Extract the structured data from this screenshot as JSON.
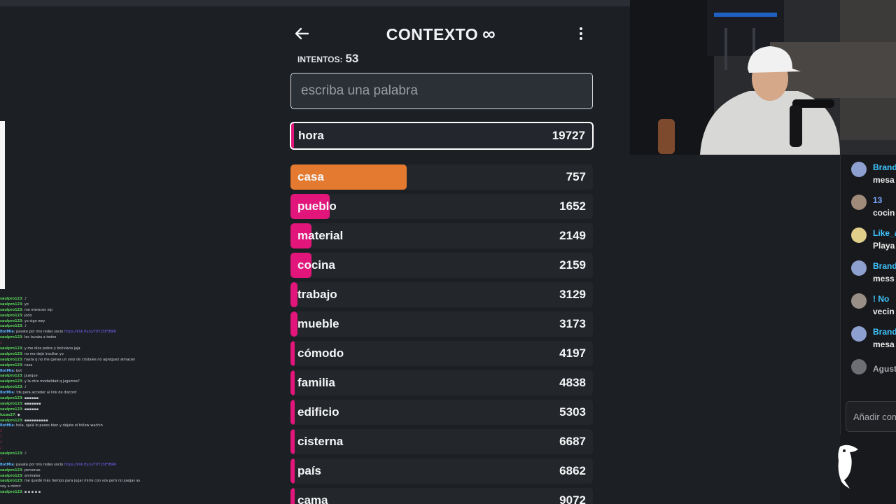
{
  "game": {
    "title": "CONTEXTO",
    "title_symbol": "∞",
    "tries_label": "INTENTOS:",
    "tries_value": "53",
    "input_placeholder": "escriba una palabra",
    "current_guess": {
      "word": "hora",
      "score": "19727"
    },
    "guesses": [
      {
        "word": "casa",
        "score": "757",
        "fill": 0.385,
        "color": "#e47a30"
      },
      {
        "word": "pueblo",
        "score": "1652",
        "fill": 0.13,
        "color": "#e2157a"
      },
      {
        "word": "material",
        "score": "2149",
        "fill": 0.07,
        "color": "#e2157a"
      },
      {
        "word": "cocina",
        "score": "2159",
        "fill": 0.07,
        "color": "#e2157a"
      },
      {
        "word": "trabajo",
        "score": "3129",
        "fill": 0.022,
        "color": "#e2157a"
      },
      {
        "word": "mueble",
        "score": "3173",
        "fill": 0.022,
        "color": "#e2157a"
      },
      {
        "word": "cómodo",
        "score": "4197",
        "fill": 0.012,
        "color": "#e2157a"
      },
      {
        "word": "familia",
        "score": "4838",
        "fill": 0.01,
        "color": "#e2157a"
      },
      {
        "word": "edificio",
        "score": "5303",
        "fill": 0.01,
        "color": "#e2157a"
      },
      {
        "word": "cisterna",
        "score": "6687",
        "fill": 0.01,
        "color": "#e2157a"
      },
      {
        "word": "país",
        "score": "6862",
        "fill": 0.01,
        "color": "#e2157a"
      },
      {
        "word": "cama",
        "score": "9072",
        "fill": 0.01,
        "color": "#e2157a"
      }
    ]
  },
  "right_chat": {
    "messages": [
      {
        "name": "Brand",
        "msg": "mesa",
        "avatar_color": "#8ea0cf",
        "name_color": "#3ec5ff"
      },
      {
        "name": "13",
        "msg": "cocin",
        "avatar_color": "#a08a7a",
        "name_color": "#7aa7ff"
      },
      {
        "name": "Like_a",
        "msg": "Playa",
        "avatar_color": "#e0cf8a",
        "name_color": "#3ec5ff"
      },
      {
        "name": "Brand",
        "msg": "mess",
        "avatar_color": "#8ea0cf",
        "name_color": "#3ec5ff"
      },
      {
        "name": "! No",
        "msg": "vecin",
        "avatar_color": "#9a8f86",
        "name_color": "#3ec5ff"
      },
      {
        "name": "Brand",
        "msg": "mesa",
        "avatar_color": "#8ea0cf",
        "name_color": "#3ec5ff"
      },
      {
        "name": "Agust",
        "msg": "",
        "avatar_color": "#6d6f74",
        "name_color": "#a5a8ad"
      }
    ],
    "input_placeholder": "Añadir com"
  },
  "left_chat": {
    "lines": [
      {
        "nick": "saulpro123",
        "text": ": ♪"
      },
      {
        "nick": "saulpro123",
        "text": ": yo"
      },
      {
        "nick": "saulpro123",
        "text": ": me mereces vip"
      },
      {
        "nick": "saulpro123",
        "text": ": jodo"
      },
      {
        "nick": "saulpro123",
        "text": ": yo sigo wey"
      },
      {
        "nick": "saulpro123",
        "text": ": ♪"
      },
      {
        "nick": "BotMia",
        "text": ": pasate por mis redes socio ",
        "link": "https://link.fly.to/70Y1SEYBR6",
        "bot": true
      },
      {
        "nick": "saulpro123",
        "text": ": les lavaba a todos"
      },
      {
        "nick": "",
        "text": "♪",
        "red": true
      },
      {
        "nick": "saulpro123",
        "text": ": y me dice pobre y boliviano jaja"
      },
      {
        "nick": "saulpro123",
        "text": ": no me dejó insultar yo"
      },
      {
        "nick": "saulpro123",
        "text": ": hasta q no me ganas un yoyi de cristales no agreguez almacen"
      },
      {
        "nick": "saulpro123",
        "text": ": casa"
      },
      {
        "nick": "BotMia",
        "text": ": bot",
        "bot": true
      },
      {
        "nick": "saulpro123",
        "text": ": pueque"
      },
      {
        "nick": "saulpro123",
        "text": ": y la otra modalidad q jugamos?"
      },
      {
        "nick": "saulpro123",
        "text": ": ♪"
      },
      {
        "nick": "BotMia",
        "text": ": !ds para acceder al link de discord",
        "bot": true
      },
      {
        "nick": "saulpro123",
        "text": ": ▪▪▪▪▪▪"
      },
      {
        "nick": "saulpro123",
        "text": ": ▪▪▪▪▪▪▪"
      },
      {
        "nick": "saulpro123",
        "text": ": ▪▪▪▪▪▪"
      },
      {
        "nick": "lucas27",
        "text": ": ◆"
      },
      {
        "nick": "saulpro123",
        "text": ": ▪▪▪▪▪▪▪▪▪▪"
      },
      {
        "nick": "BotMia",
        "text": ": hola, ojalá lo pases bien y déjate el follow wachin",
        "bot": true
      },
      {
        "nick": "",
        "text": "♪",
        "red": true
      },
      {
        "nick": "",
        "text": "♪",
        "red": true
      },
      {
        "nick": "",
        "text": "♪",
        "red": true
      },
      {
        "nick": "",
        "text": "♪",
        "red": true
      },
      {
        "nick": "saulpro123",
        "text": ": ♪"
      },
      {
        "nick": "",
        "text": "♪",
        "red": true
      },
      {
        "nick": "BotMia",
        "text": ": pasate por mis redes socio ",
        "link": "https://link.fly.to/70Y1SEYBR6",
        "bot": true
      },
      {
        "nick": "saulpro123",
        "text": ": personas"
      },
      {
        "nick": "saulpro123",
        "text": ": animales"
      },
      {
        "nick": "saulpro123",
        "text": ": me quedé más tiempo para jugar mirre con vos pero no juegas así q"
      },
      {
        "nick": "",
        "text": "voy a mimir"
      },
      {
        "nick": "saulpro123",
        "text": ": ▪ ▪ ▪ ▪ ▪"
      }
    ]
  }
}
